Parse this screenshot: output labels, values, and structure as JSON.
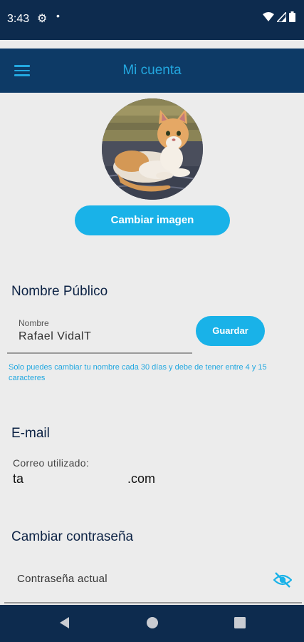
{
  "status_bar": {
    "time": "3:43",
    "icons": [
      "gear-icon",
      "dot-icon",
      "wifi-icon",
      "signal-icon",
      "battery-icon"
    ]
  },
  "app_bar": {
    "title": "Mi cuenta",
    "menu_icon": "hamburger-icon"
  },
  "profile": {
    "change_image_label": "Cambiar imagen"
  },
  "public_name": {
    "title": "Nombre Público",
    "field_label": "Nombre",
    "field_value": "Rafael VidalT",
    "save_label": "Guardar",
    "hint": "Solo puedes cambiar tu nombre cada 30 días y debe de tener entre 4 y 15 caracteres"
  },
  "email": {
    "title": "E-mail",
    "label": "Correo utilizado:",
    "value_prefix": "ta",
    "value_suffix": ".com"
  },
  "password": {
    "title": "Cambiar contraseña",
    "current_placeholder": "Contraseña actual",
    "visibility_icon": "eye-off-icon"
  },
  "nav": {
    "icons": [
      "back-icon",
      "home-icon",
      "recents-icon"
    ]
  },
  "colors": {
    "primary": "#0d3a66",
    "accent": "#19b2e8",
    "status": "#0d2b4e",
    "background": "#ececec"
  }
}
